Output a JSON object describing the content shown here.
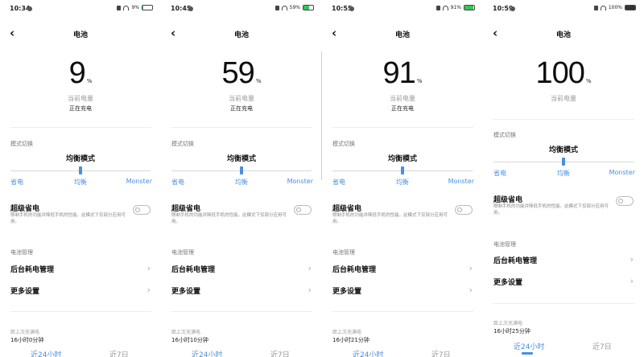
{
  "common": {
    "title": "电池",
    "current_label": "当前电量",
    "pct_unit": "%",
    "mode_section_label": "模式切换",
    "mode_name": "均衡模式",
    "mode_options": [
      "省电",
      "均衡",
      "Monster"
    ],
    "super_saver_title": "超级省电",
    "super_saver_desc": "限制手机的功能并降低手机的性能。此模式下仅部分应用可用。",
    "battery_mgmt_label": "电池管理",
    "background_mgmt": "后台耗电管理",
    "more_settings": "更多设置",
    "last_full_label": "距上次充满电",
    "tabs": [
      "近24小时",
      "近7日"
    ]
  },
  "screens": [
    {
      "time": "10:34",
      "status_pct": "9%",
      "percent": "9",
      "charging": "正在充电",
      "last_full": "16小时0分钟"
    },
    {
      "time": "10:45",
      "status_pct": "59%",
      "percent": "59",
      "charging": "正在充电",
      "last_full": "16小时10分钟"
    },
    {
      "time": "10:55",
      "status_pct": "91%",
      "percent": "91",
      "charging": "正在充电",
      "last_full": "16小时21分钟"
    },
    {
      "time": "10:59",
      "status_pct": "100%",
      "percent": "100",
      "charging": "",
      "last_full": "16小时25分钟"
    }
  ],
  "colors": {
    "accent": "#4a8fe0",
    "battery_green": "#33c55a"
  },
  "icons": [
    "back-arrow-icon",
    "chevron-right-icon",
    "wifi-icon",
    "battery-icon",
    "toggle-switch"
  ]
}
